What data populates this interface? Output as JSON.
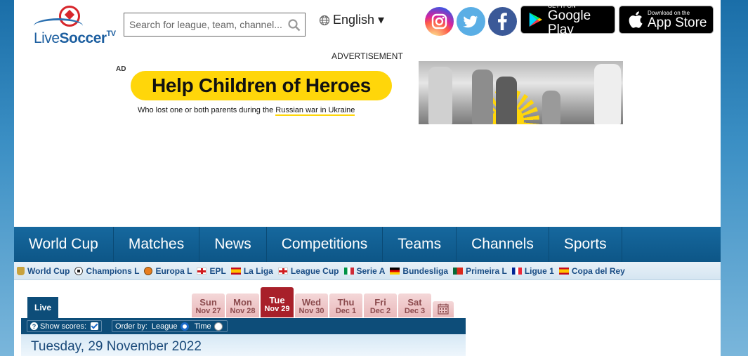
{
  "logo": {
    "brand_light": "Live",
    "brand_bold": "Soccer",
    "brand_sup": "TV"
  },
  "search": {
    "placeholder": "Search for league, team, channel..."
  },
  "language": {
    "label": "English ▾"
  },
  "stores": {
    "google_small": "GET IT ON",
    "google_big": "Google Play",
    "apple_small": "Download on the",
    "apple_big": "App Store"
  },
  "ad": {
    "advertisement_label": "ADVERTISEMENT",
    "ad_tag": "AD",
    "headline": "Help Children of Heroes",
    "subline_start": "Who lost one or both parents during the ",
    "subline_link": "Russian war in Ukraine"
  },
  "main_nav": [
    "World Cup",
    "Matches",
    "News",
    "Competitions",
    "Teams",
    "Channels",
    "Sports"
  ],
  "leagues": [
    {
      "label": "World Cup",
      "icon": "trophy"
    },
    {
      "label": "Champions L",
      "icon": "ball"
    },
    {
      "label": "Europa L",
      "icon": "el"
    },
    {
      "label": "EPL",
      "icon": "eng"
    },
    {
      "label": "La Liga",
      "icon": "esp"
    },
    {
      "label": "League Cup",
      "icon": "eng"
    },
    {
      "label": "Serie A",
      "icon": "ita"
    },
    {
      "label": "Bundesliga",
      "icon": "ger"
    },
    {
      "label": "Primeira L",
      "icon": "por"
    },
    {
      "label": "Ligue 1",
      "icon": "fra"
    },
    {
      "label": "Copa del Rey",
      "icon": "esp"
    }
  ],
  "scores": {
    "live_tab": "Live",
    "days": [
      {
        "name": "Sun",
        "date": "Nov 27"
      },
      {
        "name": "Mon",
        "date": "Nov 28"
      },
      {
        "name": "Tue",
        "date": "Nov 29"
      },
      {
        "name": "Wed",
        "date": "Nov 30"
      },
      {
        "name": "Thu",
        "date": "Dec 1"
      },
      {
        "name": "Fri",
        "date": "Dec 2"
      },
      {
        "name": "Sat",
        "date": "Dec 3"
      }
    ],
    "active_day": "Tue",
    "show_scores_label": "Show scores:",
    "show_scores_checked": true,
    "order_by_label": "Order by:",
    "order_league": "League",
    "order_time": "Time",
    "order_selected": "League",
    "date_heading": "Tuesday, 29 November 2022"
  }
}
